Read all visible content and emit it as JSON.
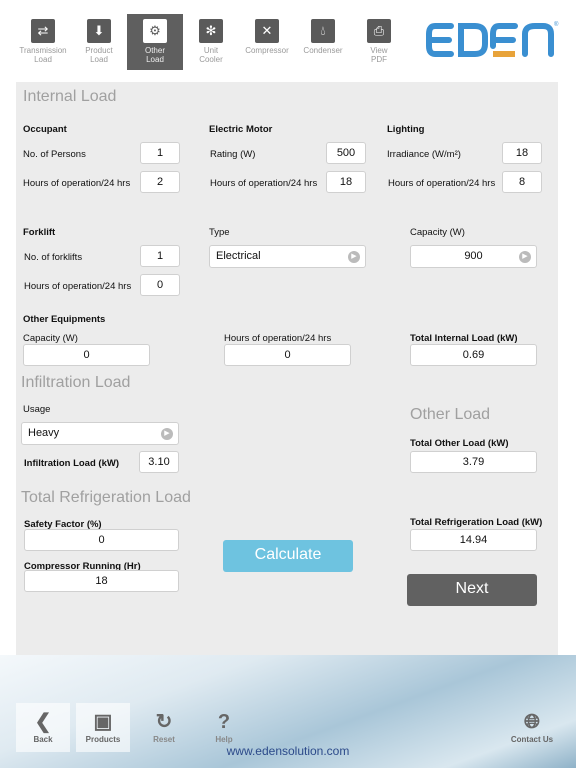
{
  "toolbar": {
    "tabs": [
      {
        "label1": "Transmission",
        "label2": "Load",
        "icon": "box-arrows-icon"
      },
      {
        "label1": "Product",
        "label2": "Load",
        "icon": "box-download-icon"
      },
      {
        "label1": "Other",
        "label2": "Load",
        "icon": "box-gears-icon",
        "active": true
      },
      {
        "label1": "Unit",
        "label2": "Cooler",
        "icon": "box-fan-icon"
      },
      {
        "label1": "Compressor",
        "label2": "",
        "icon": "box-compress-icon"
      },
      {
        "label1": "Condenser",
        "label2": "",
        "icon": "box-drops-icon"
      },
      {
        "label1": "View",
        "label2": "PDF",
        "icon": "printer-icon"
      }
    ],
    "logo": "EDEN",
    "brand_color": "#3a8fd1",
    "accent_color": "#e8a33a"
  },
  "internal": {
    "title": "Internal Load",
    "occupant": {
      "title": "Occupant",
      "persons_label": "No. of Persons",
      "persons": "1",
      "hours_label": "Hours of operation/24 hrs",
      "hours": "2"
    },
    "motor": {
      "title": "Electric Motor",
      "rating_label": "Rating (W)",
      "rating": "500",
      "hours_label": "Hours of operation/24 hrs",
      "hours": "18"
    },
    "lighting": {
      "title": "Lighting",
      "irr_label": "Irradiance (W/m²)",
      "irr": "18",
      "hours_label": "Hours of operation/24 hrs",
      "hours": "8"
    },
    "forklift": {
      "title": "Forklift",
      "count_label": "No. of forklifts",
      "count": "1",
      "hours_label": "Hours of operation/24 hrs",
      "hours": "0",
      "type_label": "Type",
      "type": "Electrical",
      "cap_label": "Capacity (W)",
      "cap": "900"
    },
    "other": {
      "title": "Other Equipments",
      "cap_label": "Capacity (W)",
      "cap": "0",
      "hours_label": "Hours of operation/24 hrs",
      "hours": "0"
    },
    "total_label": "Total Internal Load (kW)",
    "total": "0.69"
  },
  "infiltration": {
    "title": "Infiltration Load",
    "usage_label": "Usage",
    "usage": "Heavy",
    "load_label": "Infiltration Load (kW)",
    "load": "3.10"
  },
  "other_load": {
    "title": "Other Load",
    "total_label": "Total Other Load (kW)",
    "total": "3.79"
  },
  "refrig": {
    "title": "Total Refrigeration Load",
    "safety_label": "Safety Factor (%)",
    "safety": "0",
    "comp_label": "Compressor Running (Hr)",
    "comp": "18",
    "total_label": "Total Refrigeration Load (kW)",
    "total": "14.94",
    "calculate": "Calculate",
    "next": "Next"
  },
  "footer": {
    "back": "Back",
    "products": "Products",
    "reset": "Reset",
    "help": "Help",
    "contact": "Contact Us",
    "url": "www.edensolution.com"
  }
}
